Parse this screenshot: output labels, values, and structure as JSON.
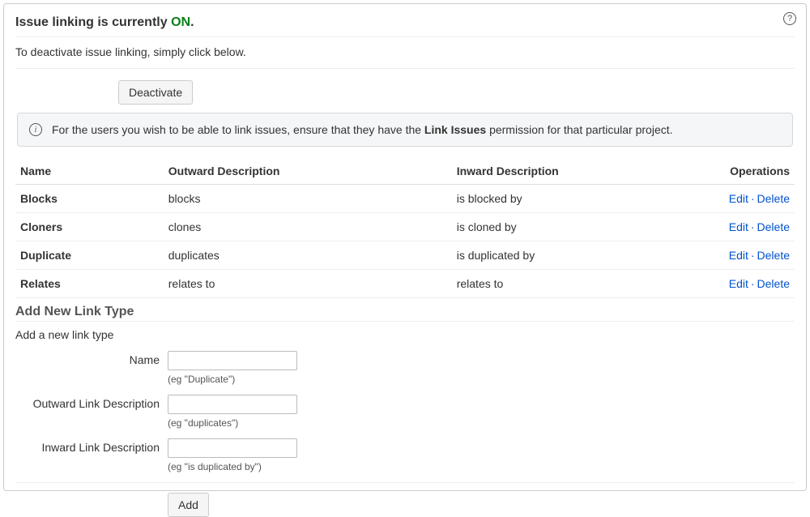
{
  "header": {
    "title_prefix": "Issue linking is currently ",
    "title_status": "ON",
    "title_suffix": ".",
    "deactivate_text": "To deactivate issue linking, simply click below.",
    "deactivate_button": "Deactivate"
  },
  "info": {
    "text_before": "For the users you wish to be able to link issues, ensure that they have the ",
    "bold_part": "Link Issues",
    "text_after": " permission for that particular project."
  },
  "table": {
    "headers": {
      "name": "Name",
      "outward": "Outward Description",
      "inward": "Inward Description",
      "operations": "Operations"
    },
    "rows": [
      {
        "name": "Blocks",
        "outward": "blocks",
        "inward": "is blocked by"
      },
      {
        "name": "Cloners",
        "outward": "clones",
        "inward": "is cloned by"
      },
      {
        "name": "Duplicate",
        "outward": "duplicates",
        "inward": "is duplicated by"
      },
      {
        "name": "Relates",
        "outward": "relates to",
        "inward": "relates to"
      }
    ],
    "edit_label": "Edit",
    "delete_label": "Delete"
  },
  "add_form": {
    "heading": "Add New Link Type",
    "subtext": "Add a new link type",
    "name_label": "Name",
    "name_hint": "(eg \"Duplicate\")",
    "outward_label": "Outward Link Description",
    "outward_hint": "(eg \"duplicates\")",
    "inward_label": "Inward Link Description",
    "inward_hint": "(eg \"is duplicated by\")",
    "add_button": "Add"
  }
}
